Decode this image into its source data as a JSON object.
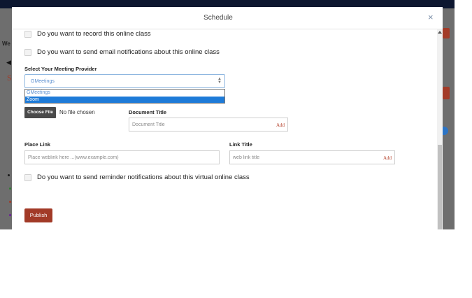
{
  "modal": {
    "title": "Schedule",
    "close_glyph": "×"
  },
  "background": {
    "partial_text": "We",
    "arrow_glyph": "◀",
    "partial_heading": "S"
  },
  "options": {
    "record": "Do you want to record this online class",
    "email": "Do you want to send email notifications about this online class",
    "reminder": "Do you want to send reminder notifications about this virtual online class"
  },
  "provider": {
    "label": "Select Your Meeting Provider",
    "selected": "GMeetings",
    "options": [
      "GMeetings",
      "Zoom"
    ],
    "highlighted": "Zoom"
  },
  "file": {
    "button_label": "Choose File",
    "status": "No file chosen"
  },
  "document": {
    "label": "Document Title",
    "placeholder": "Document Title",
    "add_label": "Add"
  },
  "place_link": {
    "label": "Place Link",
    "placeholder": "Place weblink here ...(www.example.com)"
  },
  "link_title": {
    "label": "Link Title",
    "placeholder": "web link title",
    "add_label": "Add"
  },
  "publish_label": "Publish",
  "colors": {
    "accent": "#a23a27",
    "select_border": "#8fb7e0",
    "dropdown_highlight": "#1e7bd8",
    "dark_navy": "#0d1730"
  },
  "icons": {
    "close": "close-icon",
    "select_arrows": "updown-arrows-icon",
    "back": "back-arrow-icon"
  }
}
